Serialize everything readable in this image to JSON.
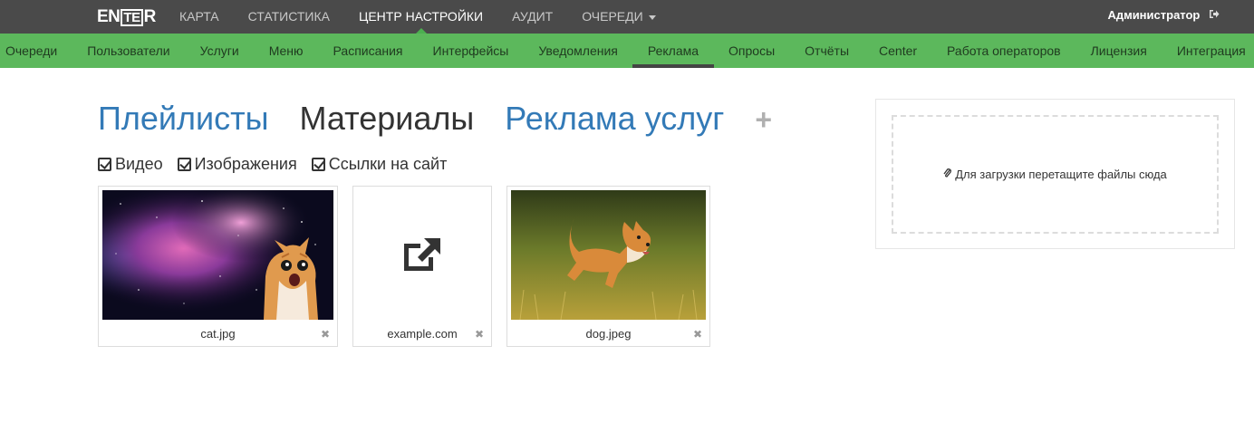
{
  "app": {
    "logo_left": "EN",
    "logo_box": "TE",
    "logo_right": "R"
  },
  "topnav": {
    "items": [
      {
        "label": "КАРТА"
      },
      {
        "label": "СТАТИСТИКА"
      },
      {
        "label": "ЦЕНТР НАСТРОЙКИ",
        "active": true
      },
      {
        "label": "АУДИТ"
      },
      {
        "label": "ОЧЕРЕДИ",
        "dropdown": true
      }
    ],
    "user": "Администратор",
    "logout_icon": "sign-out-icon"
  },
  "subnav": {
    "items": [
      {
        "label": "Очереди"
      },
      {
        "label": "Пользователи"
      },
      {
        "label": "Услуги"
      },
      {
        "label": "Меню"
      },
      {
        "label": "Расписания"
      },
      {
        "label": "Интерфейсы"
      },
      {
        "label": "Уведомления"
      },
      {
        "label": "Реклама",
        "active": true
      },
      {
        "label": "Опросы"
      },
      {
        "label": "Отчёты"
      },
      {
        "label": "Center"
      },
      {
        "label": "Работа операторов"
      },
      {
        "label": "Лицензия"
      },
      {
        "label": "Интеграция"
      }
    ]
  },
  "main": {
    "tabs": [
      {
        "label": "Плейлисты"
      },
      {
        "label": "Материалы",
        "active": true
      },
      {
        "label": "Реклама услуг"
      }
    ],
    "add_tab_label": "+",
    "filters": [
      {
        "label": "Видео",
        "checked": true
      },
      {
        "label": "Изображения",
        "checked": true
      },
      {
        "label": "Ссылки на сайт",
        "checked": true
      }
    ],
    "materials": [
      {
        "name": "cat.jpg",
        "kind": "image"
      },
      {
        "name": "example.com",
        "kind": "link"
      },
      {
        "name": "dog.jpeg",
        "kind": "image"
      }
    ],
    "remove_glyph": "✖"
  },
  "upload": {
    "text": "Для загрузки перетащите файлы сюда",
    "icon": "paperclip-icon"
  },
  "colors": {
    "topbar": "#4a4a4a",
    "subnav": "#5cb85c",
    "link": "#337ab7"
  }
}
